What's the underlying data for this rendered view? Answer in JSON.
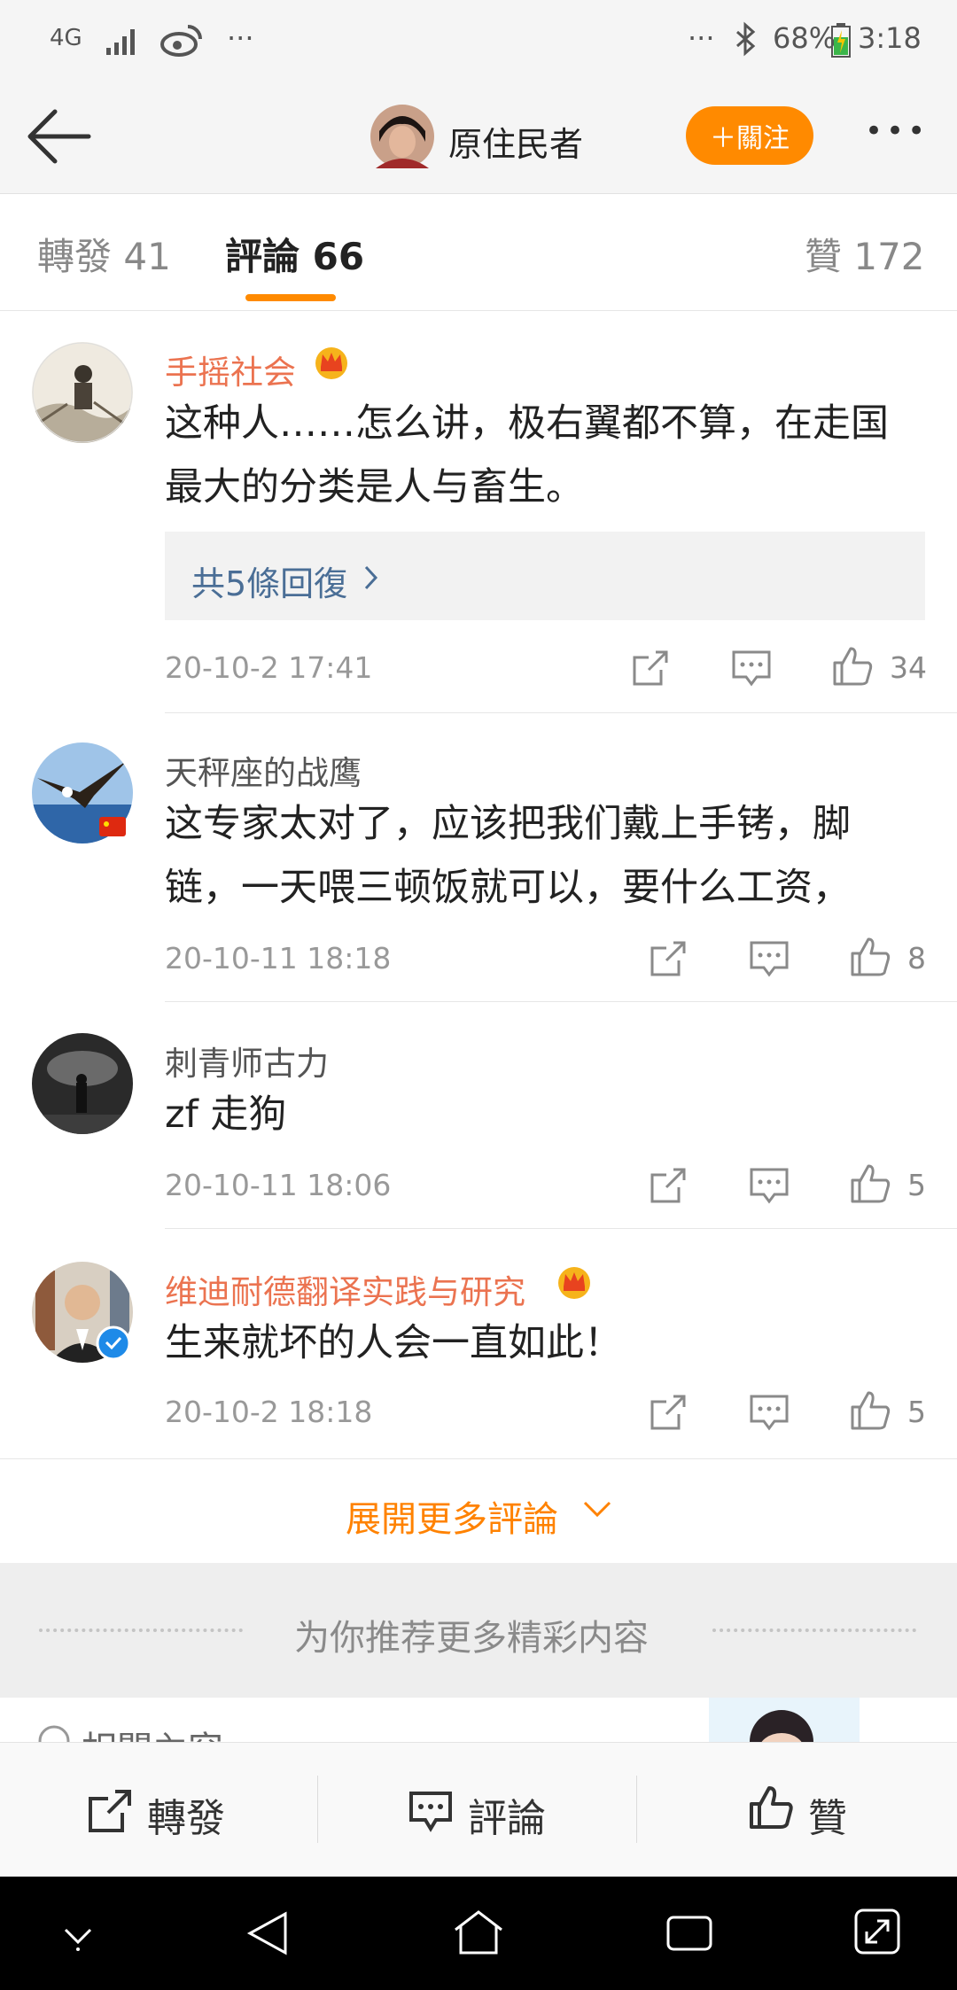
{
  "status_bar": {
    "network": "4G",
    "more_left": "···",
    "more_right": "···",
    "battery": "68%",
    "time": "3:18"
  },
  "header": {
    "user_name": "原住民者",
    "follow_label": "＋關注",
    "more_label": "•••"
  },
  "tabs": {
    "repost": "轉發 41",
    "comments": "評論 66",
    "likes": "贊 172"
  },
  "comments": [
    {
      "name": "手摇社会",
      "text_line1": "这种人……怎么讲，极右翼都不算，在走国",
      "text_line2": "最大的分类是人与畜生。",
      "replies": "共5條回復",
      "time": "20-10-2 17:41",
      "likes": "34"
    },
    {
      "name": "天秤座的战鹰",
      "text_line1": "这专家太对了，应该把我们戴上手铐，脚",
      "text_line2": "链，一天喂三顿饭就可以，要什么工资，",
      "time": "20-10-11 18:18",
      "likes": "8"
    },
    {
      "name": "刺青师古力",
      "text_line1": "zf 走狗",
      "time": "20-10-11 18:06",
      "likes": "5"
    },
    {
      "name": "维迪耐德翻译实践与研究",
      "text_line1": "生来就坏的人会一直如此！",
      "time": "20-10-2 18:18",
      "likes": "5"
    }
  ],
  "more_comments": "展開更多評論",
  "recommend": "为你推荐更多精彩内容",
  "related_partial": "相關內容",
  "bottom_bar": {
    "repost": "轉發",
    "comment": "評論",
    "like": "贊"
  },
  "colors": {
    "accent": "#ff8a00",
    "vip_name": "#eb7350",
    "link": "#4a6e96"
  }
}
